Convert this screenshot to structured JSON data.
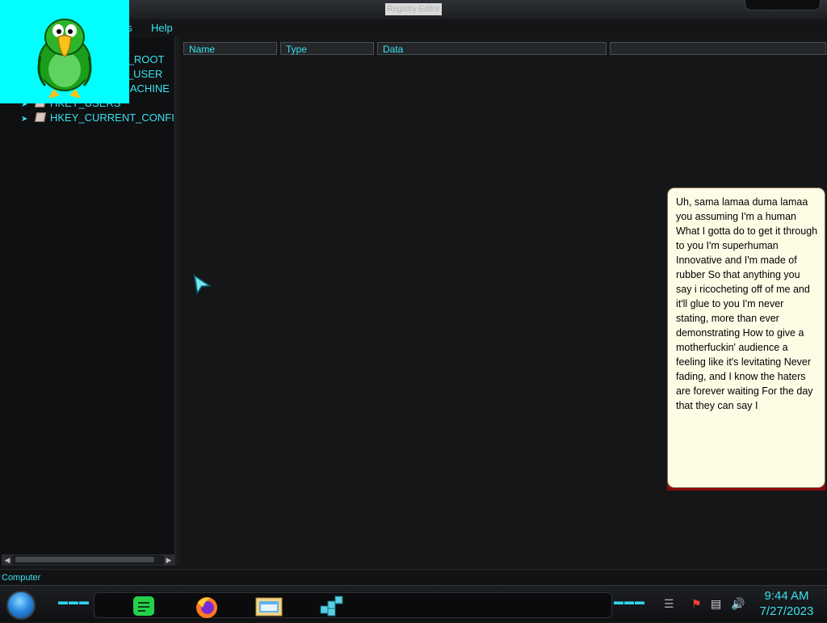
{
  "window": {
    "title": "Registry Editor"
  },
  "menu": {
    "items": [
      {
        "label": "es"
      },
      {
        "label": "Help"
      }
    ]
  },
  "tree": {
    "items": [
      {
        "label": "HKEY_CLASSES_ROOT",
        "visible_text": "S_ROOT"
      },
      {
        "label": "HKEY_CURRENT_USER",
        "visible_text": "T_USER"
      },
      {
        "label": "HKEY_LOCAL_MACHINE",
        "visible_text": "MACHINE"
      },
      {
        "label": "HKEY_USERS",
        "visible_text": "HKEY_USERS"
      },
      {
        "label": "HKEY_CURRENT_CONFIG",
        "visible_text": "HKEY_CURRENT_CONFI"
      }
    ]
  },
  "columns": [
    {
      "label": "Name"
    },
    {
      "label": "Type"
    },
    {
      "label": "Data"
    },
    {
      "label": ""
    }
  ],
  "statusbar": {
    "text": "Computer"
  },
  "balloon": {
    "text": "Uh, sama lamaa duma lamaa you assuming I'm a human What I gotta do to get it through to you I'm superhuman Innovative and I'm made of rubber So that anything you say i ricocheting off of me and it'll glue to you I'm never stating, more than ever demonstrating How to give a motherfuckin' audience a feeling like it's levitating Never fading, and I know the haters are forever waiting For the day that they can say I"
  },
  "taskbar": {
    "apps": [
      {
        "name": "notes-app-icon"
      },
      {
        "name": "firefox-icon"
      },
      {
        "name": "file-explorer-icon"
      },
      {
        "name": "registry-editor-icon"
      }
    ],
    "clock": {
      "time": "9:44 AM",
      "date": "7/27/2023"
    }
  },
  "colors": {
    "accent": "#38e3f0",
    "agent_background": "#00ffff",
    "balloon_fill": "#fdfde6",
    "balloon_shadow": "#8c0909"
  }
}
